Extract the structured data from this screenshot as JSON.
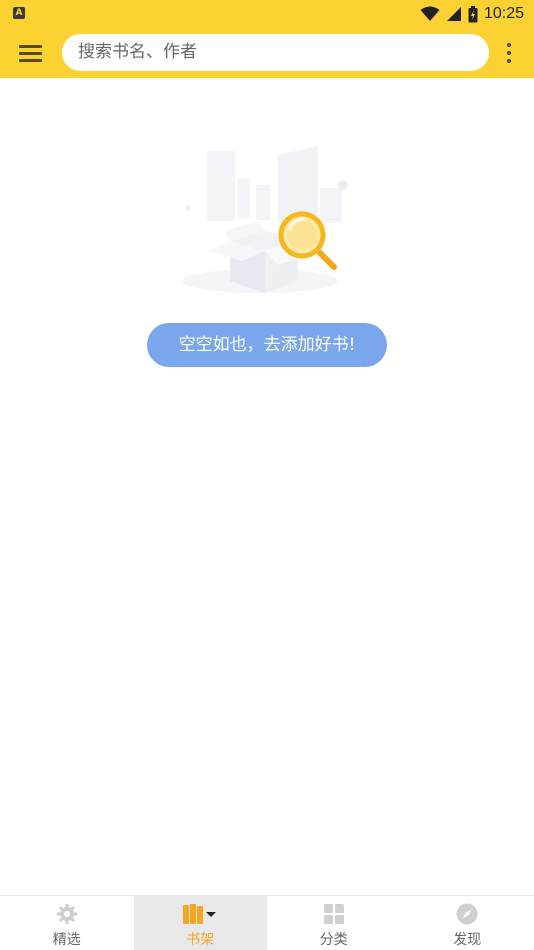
{
  "status_bar": {
    "time": "10:25",
    "app_icon_letter": "A"
  },
  "app_bar": {
    "search_placeholder": "搜索书名、作者"
  },
  "empty_state": {
    "message": "空空如也，去添加好书!"
  },
  "bottom_nav": {
    "tabs": [
      {
        "label": "精选",
        "icon": "gear-icon",
        "active": false
      },
      {
        "label": "书架",
        "icon": "bookshelf-icon",
        "active": true
      },
      {
        "label": "分类",
        "icon": "grid-icon",
        "active": false
      },
      {
        "label": "发现",
        "icon": "compass-icon",
        "active": false
      }
    ]
  },
  "colors": {
    "brand_yellow": "#fcd232",
    "active_tab": "#f5a623",
    "pill_blue": "#7aa6eb"
  }
}
